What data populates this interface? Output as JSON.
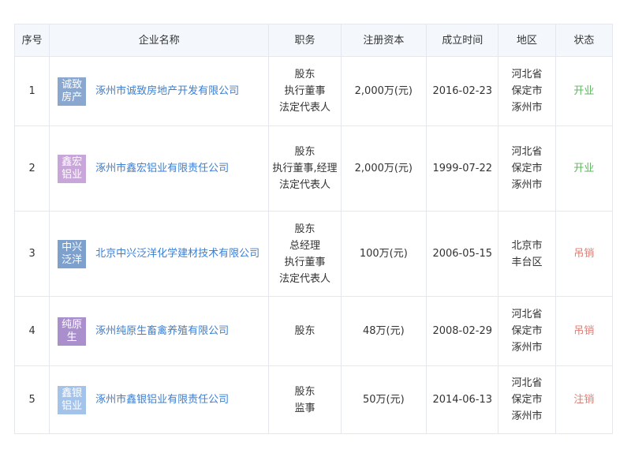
{
  "table": {
    "headers": {
      "index": "序号",
      "company": "企业名称",
      "role": "职务",
      "capital": "注册资本",
      "founded": "成立时间",
      "region": "地区",
      "status": "状态"
    },
    "rows": [
      {
        "index": "1",
        "logo_text": "诚致房产",
        "logo_color": "#8aa8cf",
        "company": "涿州市诚致房地产开发有限公司",
        "roles": [
          "股东",
          "执行董事",
          "法定代表人"
        ],
        "capital": "2,000万(元)",
        "founded": "2016-02-23",
        "region": [
          "河北省",
          "保定市",
          "涿州市"
        ],
        "status": "开业",
        "status_color": "#5cb85c"
      },
      {
        "index": "2",
        "logo_text": "鑫宏铝业",
        "logo_color": "#c9a6d9",
        "company": "涿州市鑫宏铝业有限责任公司",
        "roles": [
          "股东",
          "执行董事,经理",
          "法定代表人"
        ],
        "capital": "2,000万(元)",
        "founded": "1999-07-22",
        "region": [
          "河北省",
          "保定市",
          "涿州市"
        ],
        "status": "开业",
        "status_color": "#5cb85c"
      },
      {
        "index": "3",
        "logo_text": "中兴泛洋",
        "logo_color": "#7ea0cd",
        "company": "北京中兴泛洋化学建材技术有限公司",
        "roles": [
          "股东",
          "总经理",
          "执行董事",
          "法定代表人"
        ],
        "capital": "100万(元)",
        "founded": "2006-05-15",
        "region": [
          "北京市",
          "丰台区"
        ],
        "status": "吊销",
        "status_color": "#e07b73"
      },
      {
        "index": "4",
        "logo_text": "纯原生",
        "logo_color": "#a98fcb",
        "company": "涿州纯原生畜禽养殖有限公司",
        "roles": [
          "股东"
        ],
        "capital": "48万(元)",
        "founded": "2008-02-29",
        "region": [
          "河北省",
          "保定市",
          "涿州市"
        ],
        "status": "吊销",
        "status_color": "#e07b73"
      },
      {
        "index": "5",
        "logo_text": "鑫银铝业",
        "logo_color": "#a4c3ea",
        "company": "涿州市鑫银铝业有限责任公司",
        "roles": [
          "股东",
          "监事"
        ],
        "capital": "50万(元)",
        "founded": "2014-06-13",
        "region": [
          "河北省",
          "保定市",
          "涿州市"
        ],
        "status": "注销",
        "status_color": "#e07b73"
      }
    ]
  }
}
